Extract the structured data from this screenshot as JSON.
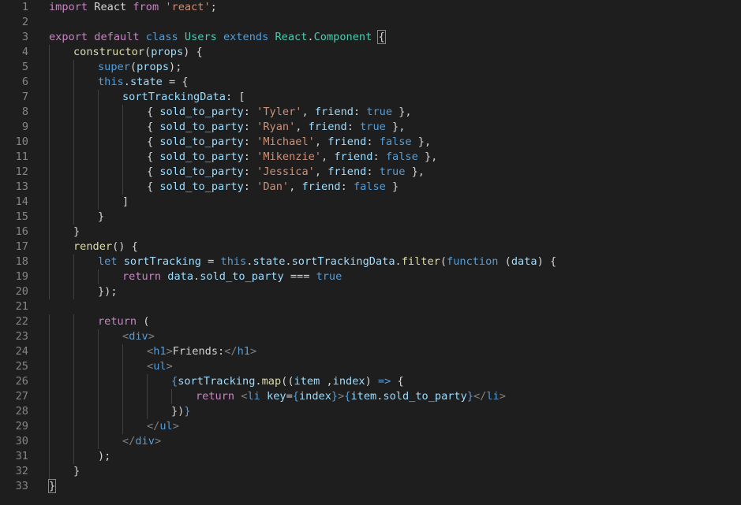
{
  "editor": {
    "lines": [
      {
        "number": "1",
        "indent": 0,
        "tokens": [
          [
            "kw",
            "import"
          ],
          [
            "plain",
            " React "
          ],
          [
            "kw",
            "from"
          ],
          [
            "plain",
            " "
          ],
          [
            "str",
            "'react'"
          ],
          [
            "plain",
            ";"
          ]
        ]
      },
      {
        "number": "2",
        "indent": 0,
        "tokens": []
      },
      {
        "number": "3",
        "indent": 0,
        "tokens": [
          [
            "kw",
            "export"
          ],
          [
            "plain",
            " "
          ],
          [
            "kw",
            "default"
          ],
          [
            "plain",
            " "
          ],
          [
            "storage",
            "class"
          ],
          [
            "plain",
            " "
          ],
          [
            "type",
            "Users"
          ],
          [
            "plain",
            " "
          ],
          [
            "storage",
            "extends"
          ],
          [
            "plain",
            " "
          ],
          [
            "type",
            "React"
          ],
          [
            "plain",
            "."
          ],
          [
            "type",
            "Component"
          ],
          [
            "plain",
            " "
          ],
          [
            "match",
            "{"
          ]
        ]
      },
      {
        "number": "4",
        "indent": 1,
        "tokens": [
          [
            "fn",
            "constructor"
          ],
          [
            "plain",
            "("
          ],
          [
            "var",
            "props"
          ],
          [
            "plain",
            ") {"
          ]
        ]
      },
      {
        "number": "5",
        "indent": 2,
        "tokens": [
          [
            "storage",
            "super"
          ],
          [
            "plain",
            "("
          ],
          [
            "var",
            "props"
          ],
          [
            "plain",
            ");"
          ]
        ]
      },
      {
        "number": "6",
        "indent": 2,
        "tokens": [
          [
            "storage",
            "this"
          ],
          [
            "plain",
            "."
          ],
          [
            "var",
            "state"
          ],
          [
            "plain",
            " = {"
          ]
        ]
      },
      {
        "number": "7",
        "indent": 3,
        "tokens": [
          [
            "prop",
            "sortTrackingData"
          ],
          [
            "plain",
            ": ["
          ]
        ]
      },
      {
        "number": "8",
        "indent": 4,
        "tokens": [
          [
            "plain",
            "{ "
          ],
          [
            "prop",
            "sold_to_party"
          ],
          [
            "plain",
            ": "
          ],
          [
            "str",
            "'Tyler'"
          ],
          [
            "plain",
            ", "
          ],
          [
            "prop",
            "friend"
          ],
          [
            "plain",
            ": "
          ],
          [
            "const",
            "true"
          ],
          [
            "plain",
            " },"
          ]
        ]
      },
      {
        "number": "9",
        "indent": 4,
        "tokens": [
          [
            "plain",
            "{ "
          ],
          [
            "prop",
            "sold_to_party"
          ],
          [
            "plain",
            ": "
          ],
          [
            "str",
            "'Ryan'"
          ],
          [
            "plain",
            ", "
          ],
          [
            "prop",
            "friend"
          ],
          [
            "plain",
            ": "
          ],
          [
            "const",
            "true"
          ],
          [
            "plain",
            " },"
          ]
        ]
      },
      {
        "number": "10",
        "indent": 4,
        "tokens": [
          [
            "plain",
            "{ "
          ],
          [
            "prop",
            "sold_to_party"
          ],
          [
            "plain",
            ": "
          ],
          [
            "str",
            "'Michael'"
          ],
          [
            "plain",
            ", "
          ],
          [
            "prop",
            "friend"
          ],
          [
            "plain",
            ": "
          ],
          [
            "const",
            "false"
          ],
          [
            "plain",
            " },"
          ]
        ]
      },
      {
        "number": "11",
        "indent": 4,
        "tokens": [
          [
            "plain",
            "{ "
          ],
          [
            "prop",
            "sold_to_party"
          ],
          [
            "plain",
            ": "
          ],
          [
            "str",
            "'Mikenzie'"
          ],
          [
            "plain",
            ", "
          ],
          [
            "prop",
            "friend"
          ],
          [
            "plain",
            ": "
          ],
          [
            "const",
            "false"
          ],
          [
            "plain",
            " },"
          ]
        ]
      },
      {
        "number": "12",
        "indent": 4,
        "tokens": [
          [
            "plain",
            "{ "
          ],
          [
            "prop",
            "sold_to_party"
          ],
          [
            "plain",
            ": "
          ],
          [
            "str",
            "'Jessica'"
          ],
          [
            "plain",
            ", "
          ],
          [
            "prop",
            "friend"
          ],
          [
            "plain",
            ": "
          ],
          [
            "const",
            "true"
          ],
          [
            "plain",
            " },"
          ]
        ]
      },
      {
        "number": "13",
        "indent": 4,
        "tokens": [
          [
            "plain",
            "{ "
          ],
          [
            "prop",
            "sold_to_party"
          ],
          [
            "plain",
            ": "
          ],
          [
            "str",
            "'Dan'"
          ],
          [
            "plain",
            ", "
          ],
          [
            "prop",
            "friend"
          ],
          [
            "plain",
            ": "
          ],
          [
            "const",
            "false"
          ],
          [
            "plain",
            " }"
          ]
        ]
      },
      {
        "number": "14",
        "indent": 3,
        "tokens": [
          [
            "plain",
            "]"
          ]
        ]
      },
      {
        "number": "15",
        "indent": 2,
        "tokens": [
          [
            "plain",
            "}"
          ]
        ]
      },
      {
        "number": "16",
        "indent": 1,
        "tokens": [
          [
            "plain",
            "}"
          ]
        ]
      },
      {
        "number": "17",
        "indent": 1,
        "tokens": [
          [
            "fn",
            "render"
          ],
          [
            "plain",
            "() {"
          ]
        ]
      },
      {
        "number": "18",
        "indent": 2,
        "tokens": [
          [
            "storage",
            "let"
          ],
          [
            "plain",
            " "
          ],
          [
            "var",
            "sortTracking"
          ],
          [
            "plain",
            " = "
          ],
          [
            "storage",
            "this"
          ],
          [
            "plain",
            "."
          ],
          [
            "var",
            "state"
          ],
          [
            "plain",
            "."
          ],
          [
            "var",
            "sortTrackingData"
          ],
          [
            "plain",
            "."
          ],
          [
            "fn",
            "filter"
          ],
          [
            "plain",
            "("
          ],
          [
            "storage",
            "function"
          ],
          [
            "plain",
            " ("
          ],
          [
            "var",
            "data"
          ],
          [
            "plain",
            ") {"
          ]
        ]
      },
      {
        "number": "19",
        "indent": 3,
        "tokens": [
          [
            "kw",
            "return"
          ],
          [
            "plain",
            " "
          ],
          [
            "var",
            "data"
          ],
          [
            "plain",
            "."
          ],
          [
            "var",
            "sold_to_party"
          ],
          [
            "plain",
            " === "
          ],
          [
            "const",
            "true"
          ]
        ]
      },
      {
        "number": "20",
        "indent": 2,
        "tokens": [
          [
            "plain",
            "});"
          ]
        ]
      },
      {
        "number": "21",
        "indent": 0,
        "tokens": []
      },
      {
        "number": "22",
        "indent": 2,
        "tokens": [
          [
            "kw",
            "return"
          ],
          [
            "plain",
            " ("
          ]
        ]
      },
      {
        "number": "23",
        "indent": 3,
        "tokens": [
          [
            "tagpunc",
            "<"
          ],
          [
            "tag",
            "div"
          ],
          [
            "tagpunc",
            ">"
          ]
        ]
      },
      {
        "number": "24",
        "indent": 4,
        "tokens": [
          [
            "tagpunc",
            "<"
          ],
          [
            "tag",
            "h1"
          ],
          [
            "tagpunc",
            ">"
          ],
          [
            "text",
            "Friends:"
          ],
          [
            "tagpunc",
            "</"
          ],
          [
            "tag",
            "h1"
          ],
          [
            "tagpunc",
            ">"
          ]
        ]
      },
      {
        "number": "25",
        "indent": 4,
        "tokens": [
          [
            "tagpunc",
            "<"
          ],
          [
            "tag",
            "ul"
          ],
          [
            "tagpunc",
            ">"
          ]
        ]
      },
      {
        "number": "26",
        "indent": 5,
        "tokens": [
          [
            "brace",
            "{"
          ],
          [
            "var",
            "sortTracking"
          ],
          [
            "plain",
            "."
          ],
          [
            "fn",
            "map"
          ],
          [
            "plain",
            "(("
          ],
          [
            "var",
            "item"
          ],
          [
            "plain",
            " ,"
          ],
          [
            "var",
            "index"
          ],
          [
            "plain",
            ") "
          ],
          [
            "storage",
            "=>"
          ],
          [
            "plain",
            " {"
          ]
        ]
      },
      {
        "number": "27",
        "indent": 6,
        "tokens": [
          [
            "kw",
            "return"
          ],
          [
            "plain",
            " "
          ],
          [
            "tagpunc",
            "<"
          ],
          [
            "tag",
            "li"
          ],
          [
            "plain",
            " "
          ],
          [
            "var",
            "key"
          ],
          [
            "plain",
            "="
          ],
          [
            "brace",
            "{"
          ],
          [
            "var",
            "index"
          ],
          [
            "brace",
            "}"
          ],
          [
            "tagpunc",
            ">"
          ],
          [
            "brace",
            "{"
          ],
          [
            "var",
            "item"
          ],
          [
            "plain",
            "."
          ],
          [
            "var",
            "sold_to_party"
          ],
          [
            "brace",
            "}"
          ],
          [
            "tagpunc",
            "</"
          ],
          [
            "tag",
            "li"
          ],
          [
            "tagpunc",
            ">"
          ]
        ]
      },
      {
        "number": "28",
        "indent": 5,
        "tokens": [
          [
            "plain",
            "})"
          ],
          [
            "brace",
            "}"
          ]
        ]
      },
      {
        "number": "29",
        "indent": 4,
        "tokens": [
          [
            "tagpunc",
            "</"
          ],
          [
            "tag",
            "ul"
          ],
          [
            "tagpunc",
            ">"
          ]
        ]
      },
      {
        "number": "30",
        "indent": 3,
        "tokens": [
          [
            "tagpunc",
            "</"
          ],
          [
            "tag",
            "div"
          ],
          [
            "tagpunc",
            ">"
          ]
        ]
      },
      {
        "number": "31",
        "indent": 2,
        "tokens": [
          [
            "plain",
            ");"
          ]
        ]
      },
      {
        "number": "32",
        "indent": 1,
        "tokens": [
          [
            "plain",
            "}"
          ]
        ]
      },
      {
        "number": "33",
        "indent": 0,
        "tokens": [
          [
            "match",
            "}"
          ]
        ]
      }
    ]
  }
}
